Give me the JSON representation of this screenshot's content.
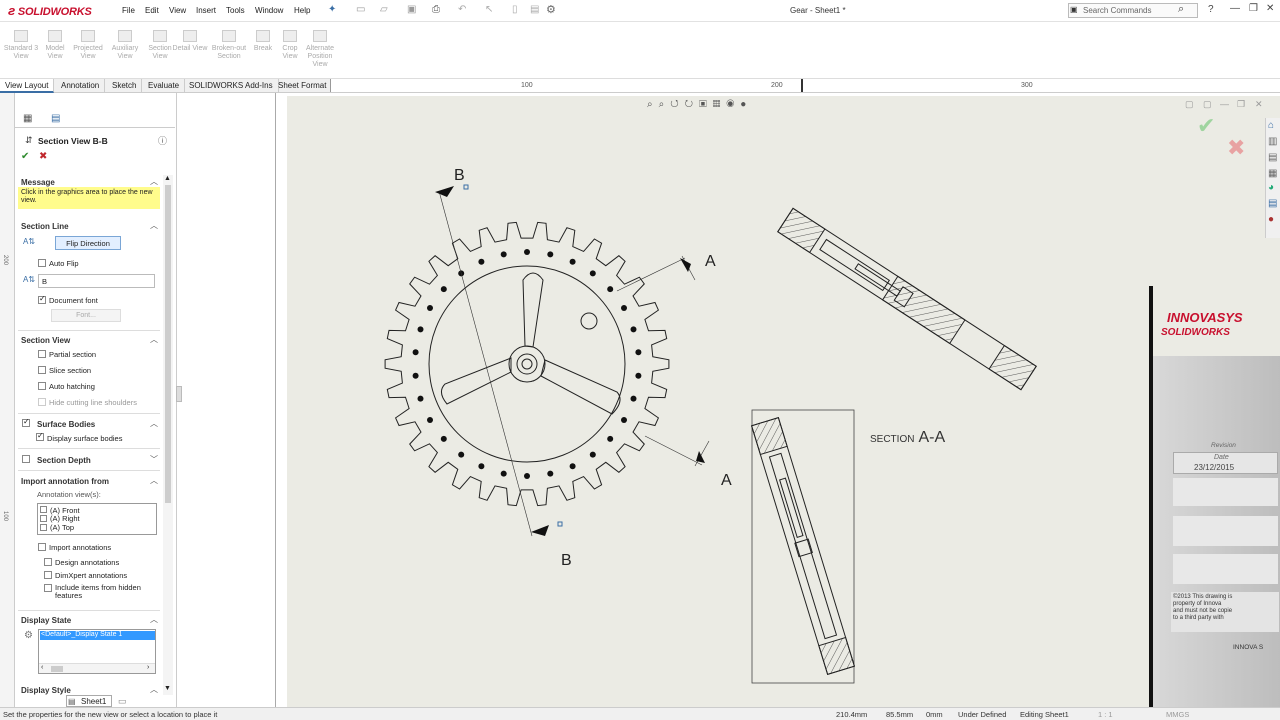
{
  "app": {
    "logo": "SOLIDWORKS",
    "document_title": "Gear - Sheet1 *"
  },
  "menu": [
    "File",
    "Edit",
    "View",
    "Insert",
    "Tools",
    "Window",
    "Help"
  ],
  "search": {
    "placeholder": "Search Commands"
  },
  "commands": [
    "Standard 3 View",
    "Model View",
    "Projected View",
    "Auxiliary View",
    "Section View",
    "Detail View",
    "Broken-out Section",
    "Break",
    "Crop View",
    "Alternate Position View"
  ],
  "tabs": [
    "View Layout",
    "Annotation",
    "Sketch",
    "Evaluate",
    "SOLIDWORKS Add-Ins",
    "Sheet Format"
  ],
  "ruler": {
    "ticks": [
      "100",
      "200",
      "300"
    ],
    "side_ticks": [
      "200",
      "100"
    ]
  },
  "panel": {
    "title": "Section View B-B",
    "message_header": "Message",
    "message": "Click in the graphics area to place the new view.",
    "section_line": "Section Line",
    "flip_direction": "Flip Direction",
    "auto_flip": "Auto Flip",
    "label_value": "B",
    "document_font": "Document font",
    "font_button": "Font...",
    "section_view": "Section View",
    "partial_section": "Partial section",
    "slice_section": "Slice section",
    "auto_hatching": "Auto hatching",
    "hide_shoulders": "Hide cutting line shoulders",
    "surface_bodies": "Surface Bodies",
    "display_surface": "Display surface bodies",
    "section_depth": "Section Depth",
    "import_annotation": "Import annotation from",
    "annotation_views": "Annotation view(s):",
    "views": [
      "(A) Front",
      "(A) Right",
      "(A) Top"
    ],
    "import_annotations": "Import annotations",
    "design_annotations": "Design annotations",
    "dimxpert": "DimXpert annotations",
    "hidden_items": "Include items from hidden features",
    "display_state": "Display State",
    "display_state_value": "<Default>_Display State 1",
    "display_style": "Display Style"
  },
  "drawing": {
    "label_b_top": "B",
    "label_b_bottom": "B",
    "label_a_top": "A",
    "label_a_bottom": "A",
    "section_prefix": "SECTION",
    "section_name": "A-A"
  },
  "titleblock": {
    "brand1": "INNOVASYS",
    "brand2": "SOLIDWORKS",
    "revision": "Revision",
    "date_label": "Date",
    "date": "23/12/2015",
    "copyright1": "©2013 This drawing is",
    "copyright2": "property of Innova",
    "copyright3": "and must not be copie",
    "copyright4": "to a third party with",
    "innova": "INNOVA S"
  },
  "sheet_tab": "Sheet1",
  "status": {
    "message": "Set the properties for the new view or select a location to place it",
    "x": "210.4mm",
    "y": "85.5mm",
    "z": "0mm",
    "state": "Under Defined",
    "editing": "Editing Sheet1",
    "scale": "1 : 1",
    "units": "MMGS"
  },
  "colors": {
    "accent": "#3a6ea5",
    "brand": "#c8102e",
    "message_bg": "#fffc8c",
    "sheet_bg": "#ebebe4"
  }
}
